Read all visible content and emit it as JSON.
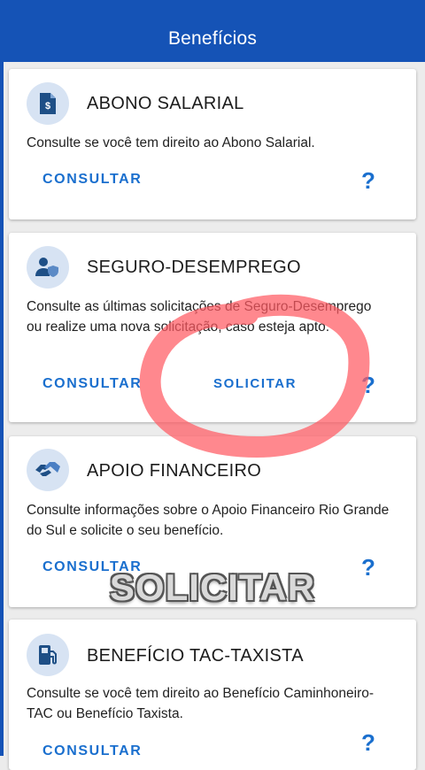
{
  "header": {
    "title": "Benefícios"
  },
  "cards": [
    {
      "title": "ABONO SALARIAL",
      "icon": "document-money-icon",
      "description": "Consulte se você tem direito ao Abono Salarial.",
      "consult_label": "CONSULTAR",
      "help_label": "?"
    },
    {
      "title": "SEGURO-DESEMPREGO",
      "icon": "person-shield-icon",
      "description": "Consulte as últimas solicitações de Seguro-Desemprego ou realize uma nova solicitação, caso esteja apto.",
      "consult_label": "CONSULTAR",
      "request_label": "SOLICITAR",
      "help_label": "?"
    },
    {
      "title": "APOIO FINANCEIRO",
      "icon": "handshake-icon",
      "description": "Consulte informações sobre o Apoio Financeiro Rio Grande do Sul e solicite o seu benefício.",
      "consult_label": "CONSULTAR",
      "help_label": "?"
    },
    {
      "title": "BENEFÍCIO TAC-TAXISTA",
      "icon": "fuel-pump-icon",
      "description": "Consulte se você tem direito ao Benefício Caminhoneiro-TAC ou Benefício Taxista.",
      "consult_label": "CONSULTAR",
      "help_label": "?"
    }
  ],
  "overlay": {
    "caption": "SOLICITAR",
    "highlight_color": "#ff5a62"
  }
}
